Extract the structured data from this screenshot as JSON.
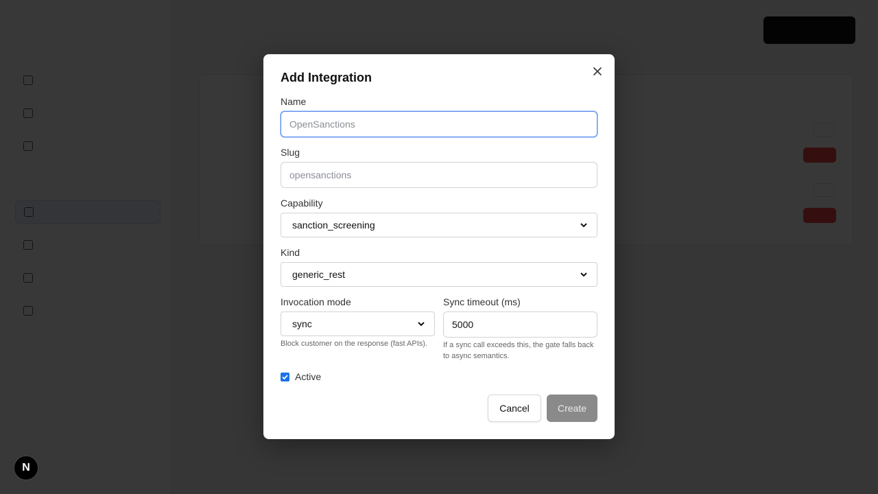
{
  "modal": {
    "title": "Add Integration",
    "name": {
      "label": "Name",
      "placeholder": "OpenSanctions",
      "value": ""
    },
    "slug": {
      "label": "Slug",
      "placeholder": "opensanctions",
      "value": ""
    },
    "capability": {
      "label": "Capability",
      "selected": "sanction_screening"
    },
    "kind": {
      "label": "Kind",
      "selected": "generic_rest"
    },
    "invocation": {
      "label": "Invocation mode",
      "selected": "sync",
      "help": "Block customer on the response (fast APIs)."
    },
    "timeout": {
      "label": "Sync timeout (ms)",
      "value": "5000",
      "help": "If a sync call exceeds this, the gate falls back to async semantics."
    },
    "active": {
      "label": "Active",
      "checked": true
    },
    "cancel_label": "Cancel",
    "create_label": "Create"
  },
  "badge": {
    "letter": "N"
  },
  "colors": {
    "accent": "#5b8def",
    "checkbox": "#1a73e8",
    "create_disabled": "#8a8a8a",
    "overlay": "#000000"
  }
}
